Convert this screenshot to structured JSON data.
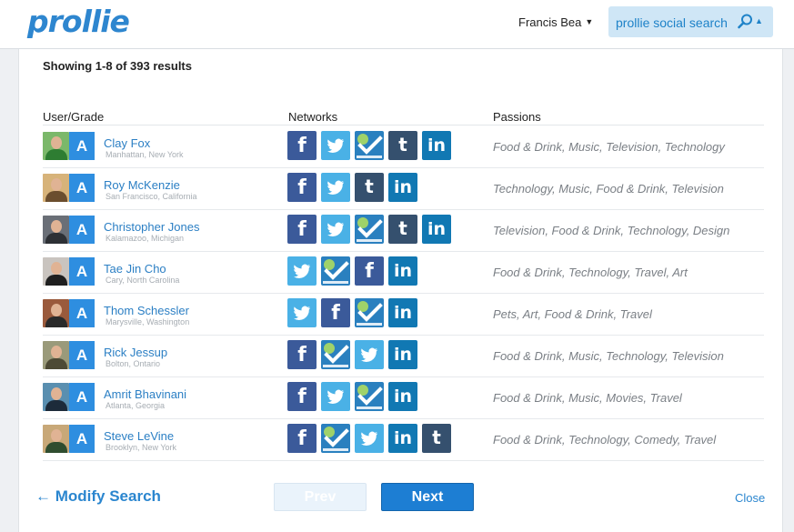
{
  "header": {
    "logo": "prollie",
    "user_name": "Francis Bea",
    "search_label": "prollie social search"
  },
  "results": {
    "summary": "Showing 1-8 of 393 results",
    "columns": {
      "user": "User/Grade",
      "networks": "Networks",
      "passions": "Passions"
    },
    "rows": [
      {
        "name": "Clay Fox",
        "location": "Manhattan, New York",
        "grade": "A",
        "networks": [
          "facebook",
          "twitter",
          "foursquare",
          "tumblr",
          "linkedin"
        ],
        "passions": "Food & Drink, Music, Television, Technology"
      },
      {
        "name": "Roy McKenzie",
        "location": "San Francisco, California",
        "grade": "A",
        "networks": [
          "facebook",
          "twitter",
          "tumblr",
          "linkedin"
        ],
        "passions": "Technology, Music, Food & Drink, Television"
      },
      {
        "name": "Christopher Jones",
        "location": "Kalamazoo, Michigan",
        "grade": "A",
        "networks": [
          "facebook",
          "twitter",
          "foursquare",
          "tumblr",
          "linkedin"
        ],
        "passions": "Television, Food & Drink, Technology, Design"
      },
      {
        "name": "Tae Jin Cho",
        "location": "Cary, North Carolina",
        "grade": "A",
        "networks": [
          "twitter",
          "foursquare",
          "facebook",
          "linkedin"
        ],
        "passions": "Food & Drink, Technology, Travel, Art"
      },
      {
        "name": "Thom Schessler",
        "location": "Marysville, Washington",
        "grade": "A",
        "networks": [
          "twitter",
          "facebook",
          "foursquare",
          "linkedin"
        ],
        "passions": "Pets, Art, Food & Drink, Travel"
      },
      {
        "name": "Rick Jessup",
        "location": "Bolton, Ontario",
        "grade": "A",
        "networks": [
          "facebook",
          "foursquare",
          "twitter",
          "linkedin"
        ],
        "passions": "Food & Drink, Music, Technology, Television"
      },
      {
        "name": "Amrit Bhavinani",
        "location": "Atlanta, Georgia",
        "grade": "A",
        "networks": [
          "facebook",
          "twitter",
          "foursquare",
          "linkedin"
        ],
        "passions": "Food & Drink, Music, Movies, Travel"
      },
      {
        "name": "Steve LeVine",
        "location": "Brooklyn, New York",
        "grade": "A",
        "networks": [
          "facebook",
          "foursquare",
          "twitter",
          "linkedin",
          "tumblr"
        ],
        "passions": "Food & Drink, Technology, Comedy, Travel"
      }
    ]
  },
  "footer": {
    "modify": "← Modify Search",
    "prev": "Prev",
    "next": "Next",
    "close": "Close"
  },
  "colors": {
    "brand": "#2e86cf",
    "facebook": "#3b5a9a",
    "twitter": "#4ab1e6",
    "foursquare": "#2a80bf",
    "tumblr": "#35506e",
    "linkedin": "#1178b3"
  }
}
